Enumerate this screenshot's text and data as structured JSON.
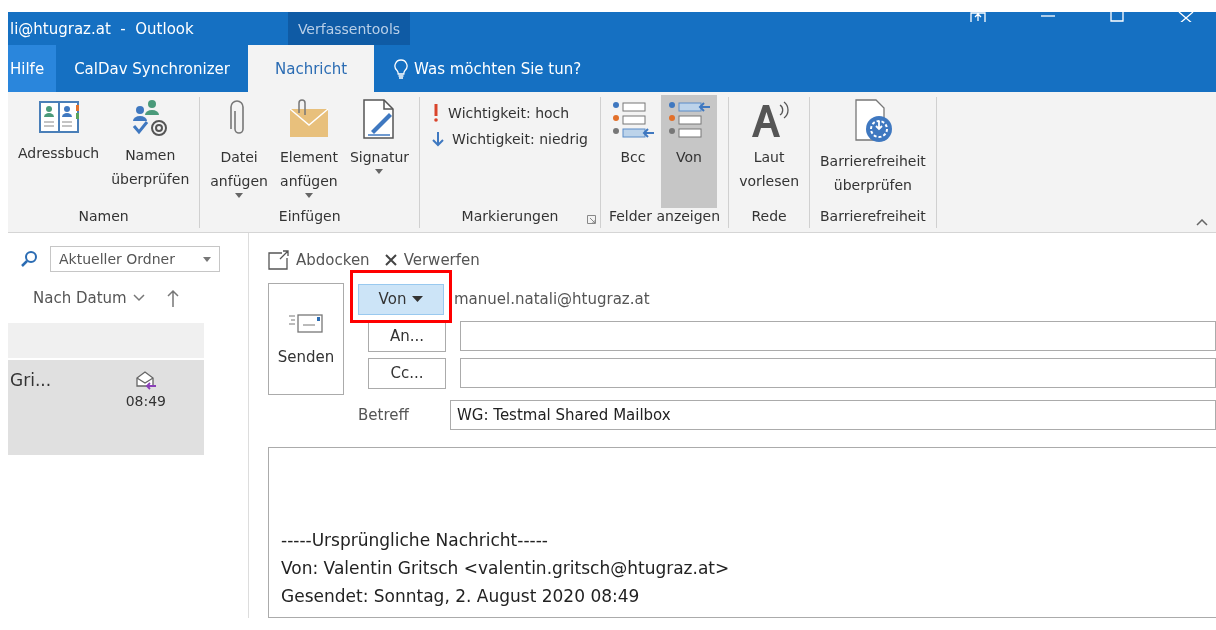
{
  "window": {
    "title": "li@htugraz.at  -  Outlook",
    "context_tab": "Verfassentools"
  },
  "ribbon_tabs": [
    {
      "label": "Hilfe",
      "selected": false,
      "hover": true
    },
    {
      "label": "CalDav Synchronizer",
      "selected": false,
      "hover": false
    },
    {
      "label": "Nachricht",
      "selected": true,
      "hover": false
    }
  ],
  "tell_me": "Was möchten Sie tun?",
  "ribbon_groups": [
    {
      "label": "Namen",
      "items": [
        {
          "kind": "large",
          "label": "Adressbuch",
          "dropdown": false,
          "selected": false
        },
        {
          "kind": "large",
          "label": "Namen\nüberprüfen",
          "dropdown": false,
          "selected": false
        }
      ]
    },
    {
      "label": "Einfügen",
      "items": [
        {
          "kind": "large",
          "label": "Datei\nanfügen",
          "dropdown": true,
          "selected": false
        },
        {
          "kind": "large",
          "label": "Element\nanfügen",
          "dropdown": true,
          "selected": false
        },
        {
          "kind": "large",
          "label": "Signatur",
          "dropdown": true,
          "selected": false
        }
      ]
    },
    {
      "label": "Markierungen",
      "launcher": true,
      "items": [
        {
          "kind": "small",
          "label": "Wichtigkeit: hoch",
          "selected": false
        },
        {
          "kind": "small",
          "label": "Wichtigkeit: niedrig",
          "selected": false
        }
      ]
    },
    {
      "label": "Felder anzeigen",
      "items": [
        {
          "kind": "large",
          "label": "Bcc",
          "dropdown": false,
          "selected": false
        },
        {
          "kind": "large",
          "label": "Von",
          "dropdown": false,
          "selected": true
        }
      ]
    },
    {
      "label": "Rede",
      "items": [
        {
          "kind": "large",
          "label": "Laut\nvorlesen",
          "dropdown": false,
          "selected": false
        }
      ]
    },
    {
      "label": "Barrierefreiheit",
      "items": [
        {
          "kind": "large",
          "label": "Barrierefreiheit\nüberprüfen",
          "dropdown": false,
          "selected": false
        }
      ]
    }
  ],
  "folder_pane": {
    "scope": "Aktueller Ordner",
    "sort": "Nach Datum",
    "messages": [
      {
        "sender": "Gri...",
        "time": "08:49",
        "selected": true
      }
    ]
  },
  "compose": {
    "toolbar": [
      "Abdocken",
      "Verwerfen"
    ],
    "send_button": "Senden",
    "from_button": {
      "label": "Von",
      "highlighted": true
    },
    "from": "manuel.natali@htugraz.at",
    "to_button": "An...",
    "cc_button": "Cc...",
    "subject_label": "Betreff",
    "subject": "WG: Testmal Shared Mailbox",
    "body": [
      "-----Ursprüngliche Nachricht-----",
      "Von: Valentin Gritsch <valentin.gritsch@htugraz.at>",
      "Gesendet: Sonntag, 2. August 2020 08:49"
    ]
  }
}
